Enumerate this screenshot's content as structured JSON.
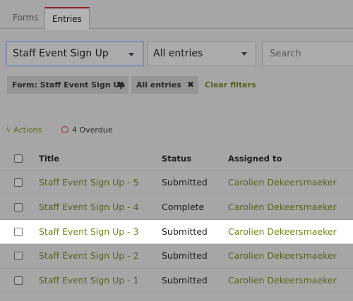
{
  "tabs": {
    "forms": "Forms",
    "entries": "Entries"
  },
  "filters": {
    "form_select": "Staff Event Sign Up",
    "entries_select": "All entries",
    "search_placeholder": "Search"
  },
  "chips": {
    "form_chip": "Form: Staff Event Sign Up",
    "all_chip": "All entries",
    "remove_symbol": "✖",
    "clear_label": "Clear filters"
  },
  "toolbar": {
    "actions_label": "Actions",
    "overdue_label": "4 Overdue"
  },
  "table": {
    "headers": {
      "title": "Title",
      "status": "Status",
      "assigned": "Assigned to"
    },
    "rows": [
      {
        "title": "Staff Event Sign Up - 5",
        "status": "Submitted",
        "assigned": "Carolien Dekeersmaeker"
      },
      {
        "title": "Staff Event Sign Up - 4",
        "status": "Complete",
        "assigned": "Carolien Dekeersmaeker"
      },
      {
        "title": "Staff Event Sign Up - 3",
        "status": "Submitted",
        "assigned": "Carolien Dekeersmaeker"
      },
      {
        "title": "Staff Event Sign Up - 2",
        "status": "Submitted",
        "assigned": "Carolien Dekeersmaeker"
      },
      {
        "title": "Staff Event Sign Up - 1",
        "status": "Submitted",
        "assigned": "Carolien Dekeersmaeker"
      }
    ]
  },
  "colors": {
    "accent_link": "#57631a",
    "active_tab_border": "#8a1f2a",
    "overdue_icon": "#a3212e",
    "overlay_background": "#a6a6a6",
    "highlight_row": "#ffffff"
  }
}
